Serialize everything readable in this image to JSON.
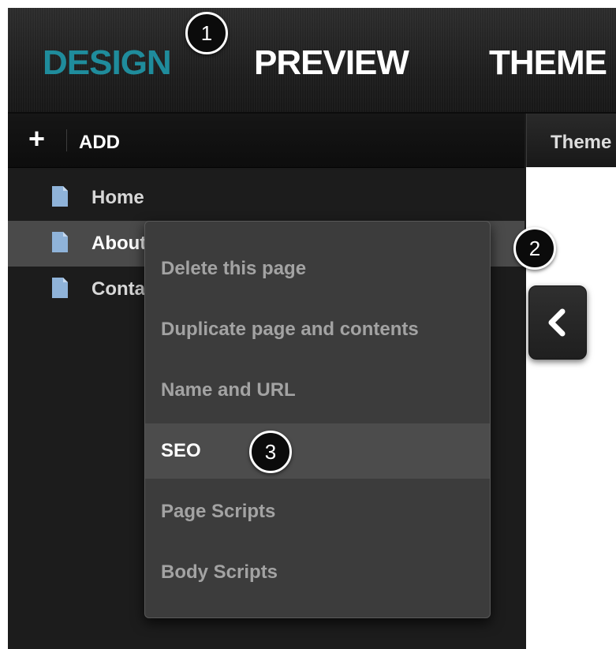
{
  "header": {
    "tabs": [
      {
        "label": "DESIGN",
        "active": true
      },
      {
        "label": "PREVIEW",
        "active": false
      },
      {
        "label": "THEME",
        "active": false
      }
    ]
  },
  "callouts": [
    "1",
    "2",
    "3"
  ],
  "sidebar": {
    "add_symbol": "+",
    "add_label": "ADD",
    "pages": [
      {
        "label": "Home"
      },
      {
        "label": "About",
        "selected": true
      },
      {
        "label": "Contact"
      }
    ]
  },
  "right_panel": {
    "tab_label": "Theme"
  },
  "context_menu": {
    "items": [
      {
        "label": "Delete this page"
      },
      {
        "label": "Duplicate page and contents"
      },
      {
        "label": "Name and URL"
      },
      {
        "label": "SEO",
        "highlighted": true
      },
      {
        "label": "Page Scripts"
      },
      {
        "label": "Body Scripts"
      }
    ]
  },
  "colors": {
    "accent": "#1f8c9c",
    "page_icon": "#8fb3d9",
    "menu_bg": "#3c3c3c",
    "menu_text": "#a3a3a3",
    "selected_row": "#4a4a4a"
  },
  "icons": {
    "page": "page-icon",
    "collapse": "chevron-left-icon"
  }
}
